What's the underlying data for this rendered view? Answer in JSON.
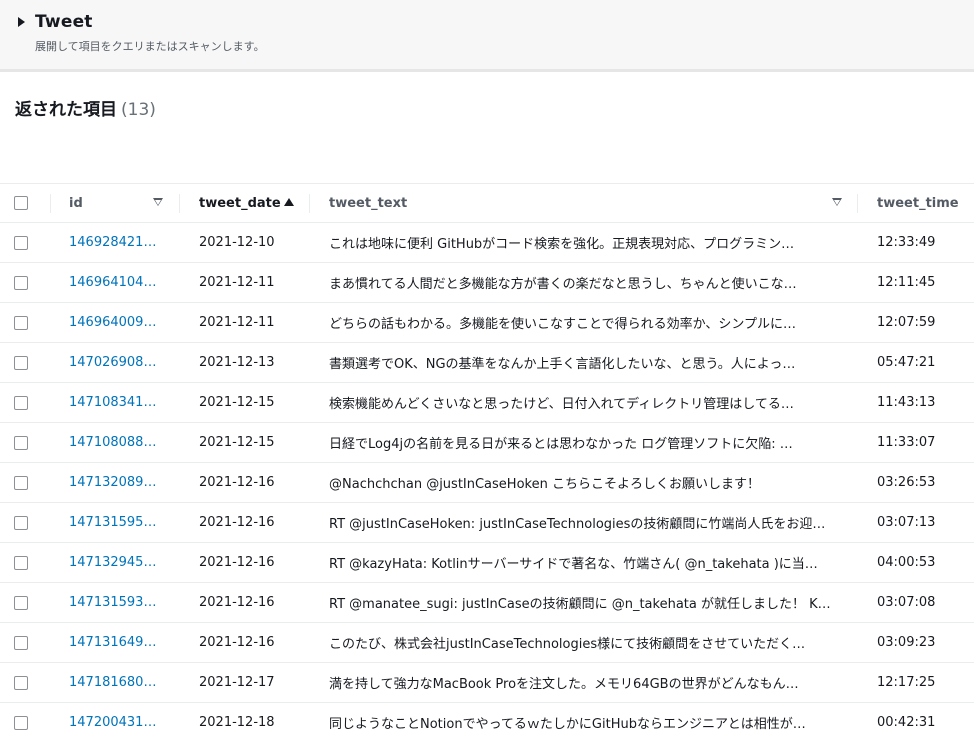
{
  "expander": {
    "title": "Tweet",
    "description": "展開して項目をクエリまたはスキャンします。"
  },
  "results": {
    "title": "返された項目",
    "count": "(13)"
  },
  "table": {
    "columns": {
      "id": "id",
      "tweet_date": "tweet_date",
      "tweet_text": "tweet_text",
      "tweet_time": "tweet_time"
    },
    "rows": [
      {
        "id": "146928421…",
        "tweet_date": "2021-12-10",
        "tweet_text": "これは地味に便利 GitHubがコード検索を強化。正規表現対応、プログラミン…",
        "tweet_time": "12:33:49"
      },
      {
        "id": "146964104…",
        "tweet_date": "2021-12-11",
        "tweet_text": "まあ慣れてる人間だと多機能な方が書くの楽だなと思うし、ちゃんと使いこな…",
        "tweet_time": "12:11:45"
      },
      {
        "id": "146964009…",
        "tweet_date": "2021-12-11",
        "tweet_text": "どちらの話もわかる。多機能を使いこなすことで得られる効率か、シンプルに…",
        "tweet_time": "12:07:59"
      },
      {
        "id": "147026908…",
        "tweet_date": "2021-12-13",
        "tweet_text": "書類選考でOK、NGの基準をなんか上手く言語化したいな、と思う。人によっ…",
        "tweet_time": "05:47:21"
      },
      {
        "id": "147108341…",
        "tweet_date": "2021-12-15",
        "tweet_text": "検索機能めんどくさいなと思ったけど、日付入れてディレクトリ管理はしてる…",
        "tweet_time": "11:43:13"
      },
      {
        "id": "147108088…",
        "tweet_date": "2021-12-15",
        "tweet_text": "日経でLog4jの名前を見る日が来るとは思わなかった ログ管理ソフトに欠陥: …",
        "tweet_time": "11:33:07"
      },
      {
        "id": "147132089…",
        "tweet_date": "2021-12-16",
        "tweet_text": "@Nachchchan @justInCaseHoken こちらこそよろしくお願いします！",
        "tweet_time": "03:26:53"
      },
      {
        "id": "147131595…",
        "tweet_date": "2021-12-16",
        "tweet_text": "RT @justInCaseHoken: justInCaseTechnologiesの技術顧問に竹端尚人氏をお迎…",
        "tweet_time": "03:07:13"
      },
      {
        "id": "147132945…",
        "tweet_date": "2021-12-16",
        "tweet_text": "RT @kazyHata: Kotlinサーバーサイドで著名な、竹端さん( @n_takehata )に当…",
        "tweet_time": "04:00:53"
      },
      {
        "id": "147131593…",
        "tweet_date": "2021-12-16",
        "tweet_text": "RT @manatee_sugi: justInCaseの技術顧問に @n_takehata が就任しました！ K…",
        "tweet_time": "03:07:08"
      },
      {
        "id": "147131649…",
        "tweet_date": "2021-12-16",
        "tweet_text": "このたび、株式会社justInCaseTechnologies様にて技術顧問をさせていただく…",
        "tweet_time": "03:09:23"
      },
      {
        "id": "147181680…",
        "tweet_date": "2021-12-17",
        "tweet_text": "満を持して強力なMacBook Proを注文した。メモリ64GBの世界がどんなもん…",
        "tweet_time": "12:17:25"
      },
      {
        "id": "147200431…",
        "tweet_date": "2021-12-18",
        "tweet_text": "同じようなことNotionでやってるｗたしかにGitHubならエンジニアとは相性が…",
        "tweet_time": "00:42:31"
      }
    ]
  }
}
